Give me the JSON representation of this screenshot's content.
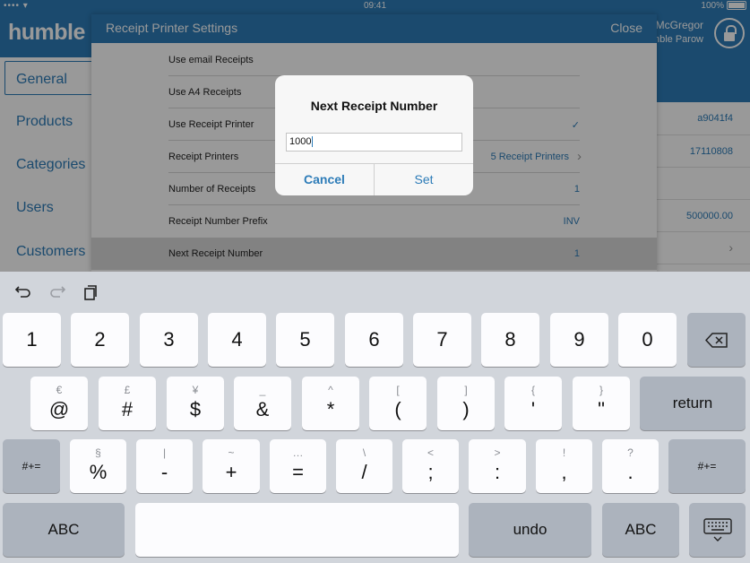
{
  "status_bar": {
    "time": "09:41",
    "battery": "100%",
    "signal": "•••• ",
    "wifi_icon": "wifi-icon"
  },
  "header": {
    "logo": "humble",
    "user_name": "McGregor",
    "user_sub": "mble Parow"
  },
  "sidebar": {
    "items": [
      {
        "label": "General",
        "active": true
      },
      {
        "label": "Products"
      },
      {
        "label": "Categories"
      },
      {
        "label": "Users"
      },
      {
        "label": "Customers"
      }
    ]
  },
  "right_panel": {
    "values": [
      "a9041f4",
      "17110808",
      "500000.00"
    ]
  },
  "settings": {
    "title": "Receipt Printer Settings",
    "close": "Close",
    "rows": [
      {
        "label": "Use email Receipts",
        "value": ""
      },
      {
        "label": "Use A4 Receipts",
        "value": ""
      },
      {
        "label": "Use Receipt Printer",
        "value": "✓"
      },
      {
        "label": "Receipt Printers",
        "value": "5 Receipt Printers"
      },
      {
        "label": "Number of Receipts",
        "value": "1"
      },
      {
        "label": "Receipt Number Prefix",
        "value": "INV"
      },
      {
        "label": "Next Receipt Number",
        "value": "1"
      }
    ]
  },
  "dialog": {
    "title": "Next Receipt Number",
    "input_value": "1000",
    "cancel": "Cancel",
    "set": "Set"
  },
  "keyboard": {
    "row1": [
      "1",
      "2",
      "3",
      "4",
      "5",
      "6",
      "7",
      "8",
      "9",
      "0"
    ],
    "row2": [
      {
        "main": "@",
        "sec": "€"
      },
      {
        "main": "#",
        "sec": "£"
      },
      {
        "main": "$",
        "sec": "¥"
      },
      {
        "main": "&",
        "sec": "_"
      },
      {
        "main": "*",
        "sec": "^"
      },
      {
        "main": "(",
        "sec": "["
      },
      {
        "main": ")",
        "sec": "]"
      },
      {
        "main": "'",
        "sec": "{"
      },
      {
        "main": "\"",
        "sec": "}"
      }
    ],
    "row3": [
      {
        "main": "%",
        "sec": "§"
      },
      {
        "main": "-",
        "sec": "|"
      },
      {
        "main": "+",
        "sec": "~"
      },
      {
        "main": "=",
        "sec": "…"
      },
      {
        "main": "/",
        "sec": "\\"
      },
      {
        "main": ";",
        "sec": "<"
      },
      {
        "main": ":",
        "sec": ">"
      },
      {
        "main": ",",
        "sec": "!"
      },
      {
        "main": ".",
        "sec": "?"
      }
    ],
    "return": "return",
    "shift_sym": "#+=",
    "abc": "ABC",
    "undo": "undo",
    "backspace_icon": "backspace-icon",
    "hide_icon": "keyboard-hide-icon"
  }
}
